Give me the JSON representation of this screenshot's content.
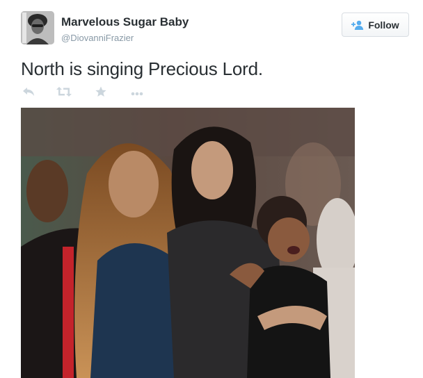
{
  "user": {
    "name": "Marvelous Sugar Baby",
    "handle": "@DiovanniFrazier",
    "avatar": "profile-photo"
  },
  "follow_button": {
    "label": "Follow",
    "icon": "add-user-icon",
    "accent": "#55acee"
  },
  "tweet": {
    "text": "North is singing Precious Lord."
  },
  "actions": [
    {
      "name": "reply",
      "icon": "reply-icon"
    },
    {
      "name": "retweet",
      "icon": "retweet-icon"
    },
    {
      "name": "favorite",
      "icon": "star-icon"
    },
    {
      "name": "more",
      "icon": "more-icon"
    }
  ],
  "media": {
    "type": "photo",
    "description": "photo-attachment"
  },
  "colors": {
    "text": "#292f33",
    "secondary": "#8899a6",
    "action_icons": "#ccd6dd"
  }
}
